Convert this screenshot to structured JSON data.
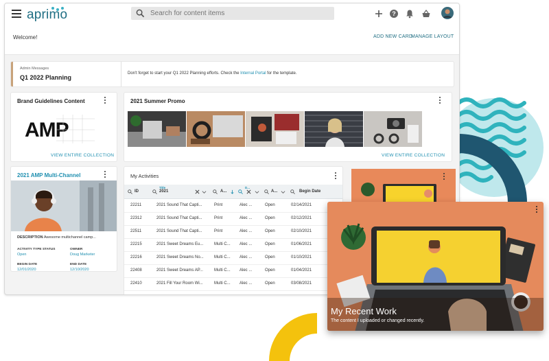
{
  "app": {
    "logo": "aprimo",
    "search_placeholder": "Search for content items",
    "icons": [
      "menu-icon",
      "search-icon",
      "plus-icon",
      "help-icon",
      "bell-icon",
      "basket-icon",
      "user-avatar"
    ]
  },
  "welcome_bar": {
    "welcome": "Welcome!",
    "add_new_card": "ADD NEW CARD",
    "manage_layout": "MANAGE LAYOUT"
  },
  "message_card": {
    "label": "Admin Messages",
    "title": "Q1 2022 Planning",
    "text_before": "Don't forget to start your Q1 2022 Planning efforts. Check the ",
    "link": "Internal Portal",
    "text_after": " for the template."
  },
  "brand_card": {
    "title": "Brand Guidelines Content",
    "logo_text": "AMP",
    "view_link": "VIEW ENTIRE COLLECTION"
  },
  "promo_card": {
    "title": "2021 Summer Promo",
    "view_link": "VIEW ENTIRE COLLECTION"
  },
  "amp_card": {
    "title": "2021 AMP Multi-Channel",
    "description_label": "DESCRIPTION",
    "description_value": "Awesome multichannel camp...",
    "activity_label": "ACTIVITY TYPE STATUS",
    "activity_value": "Open",
    "owner_label": "OWNER",
    "owner_value": "Doug Marketer",
    "begin_label": "BEGIN DATE",
    "begin_value": "12/01/2020",
    "end_label": "END DATE",
    "end_value": "12/10/2020"
  },
  "activities": {
    "title": "My Activities",
    "filter": {
      "id_label": "ID",
      "title_small": "Title",
      "title_value": "2021",
      "col3": "A...",
      "col4_small": "D...",
      "col5": "A...",
      "begin_date": "Begin Date"
    },
    "rows": [
      [
        "22211",
        "2021 Sound That Capti...",
        "Print",
        "Alec ...",
        "Open",
        "02/14/2021"
      ],
      [
        "22312",
        "2021 Sound That Capti...",
        "Print",
        "Alec ...",
        "Open",
        "02/12/2021"
      ],
      [
        "22511",
        "2021 Sound That Capti...",
        "Print",
        "Alec ...",
        "Open",
        "02/10/2021"
      ],
      [
        "22215",
        "2021 Sweet Dreams Eu...",
        "Multi C...",
        "Alec ...",
        "Open",
        "01/06/2021"
      ],
      [
        "22216",
        "2021 Sweet Dreams No...",
        "Multi C...",
        "Alec ...",
        "Open",
        "01/10/2021"
      ],
      [
        "22408",
        "2021 Sweet Dreams AP...",
        "Multi C...",
        "Alec ...",
        "Open",
        "01/04/2021"
      ],
      [
        "22410",
        "2021 Fill Your Room Wi...",
        "Multi C...",
        "Alec ...",
        "Open",
        "03/08/2021"
      ]
    ]
  },
  "recent_work": {
    "title": "My Recent Work",
    "subtitle": "The content I uploaded or changed recently."
  },
  "colors": {
    "brand": "#1f6e83",
    "link": "#1f8fb0",
    "teal_deco": "#2fb3bd",
    "navy_deco": "#1f5670",
    "yellow_deco": "#f4c20d",
    "orange_bg": "#e8895a"
  }
}
